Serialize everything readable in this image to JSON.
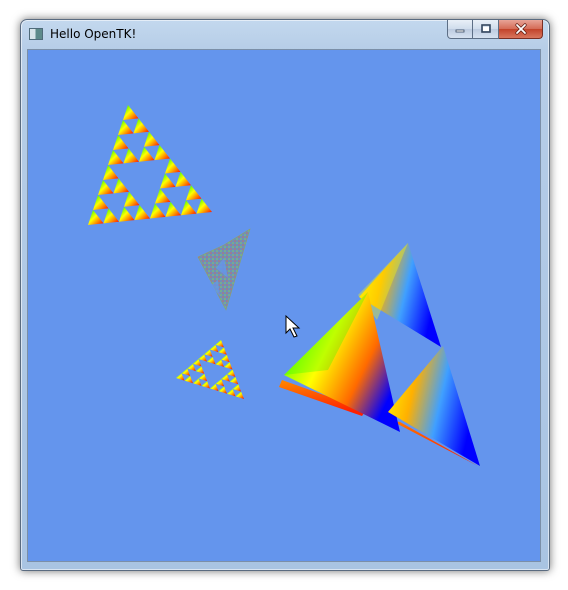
{
  "window": {
    "title": "Hello OpenTK!",
    "client_background": "#6495ed"
  },
  "caption_buttons": {
    "minimize_icon": "minimize-icon",
    "maximize_icon": "maximize-icon",
    "close_icon": "close-icon"
  },
  "scene": {
    "content": "sierpinski-triangles",
    "cursor_icon": "mouse-pointer-icon"
  }
}
